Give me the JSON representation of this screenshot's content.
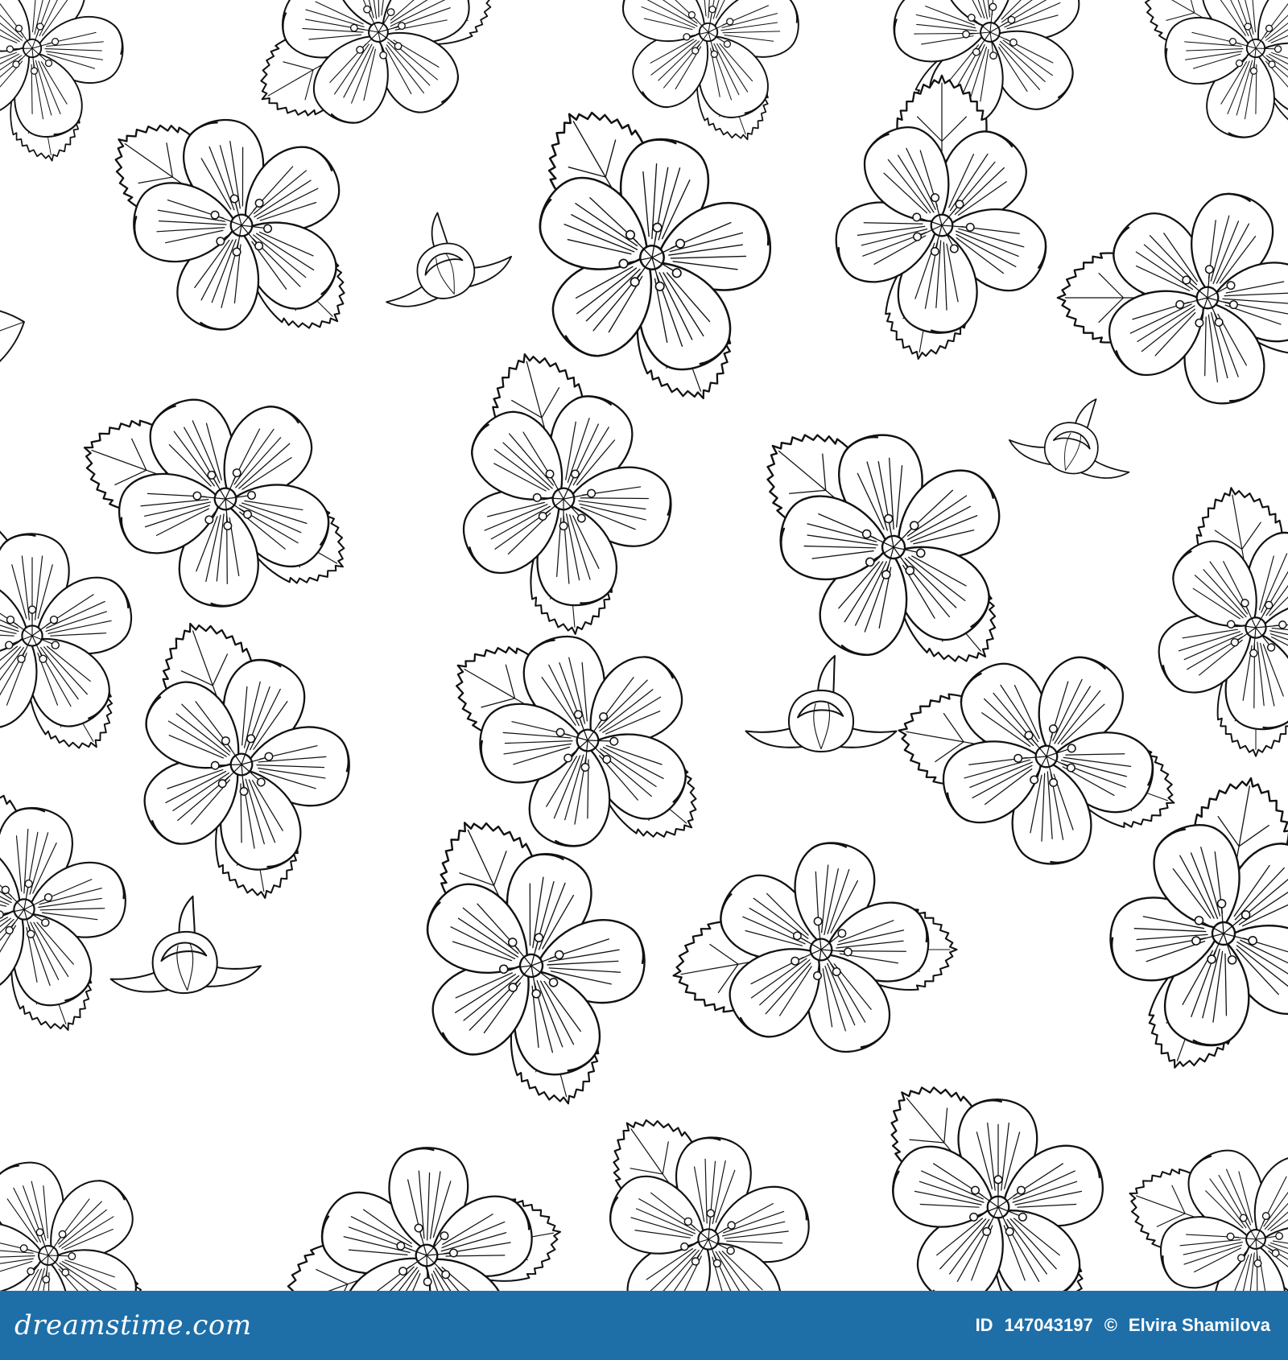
{
  "page": {
    "background_color": "#ffffff",
    "line_color": "#111111"
  },
  "pattern": {
    "motif": "apple-blossom-flower-icon",
    "secondary_motif": "flower-bud-icon",
    "leaf_motif": "serrated-leaf-icon",
    "style": "black line art, seamless floral pattern"
  },
  "footer": {
    "brand": "dreamstime.com",
    "id_label": "ID",
    "id_number": "147043197",
    "copyright_symbol": "©",
    "author": "Elvira Shamilova",
    "background_color": "#1e6fa8",
    "text_color": "#ffffff"
  }
}
